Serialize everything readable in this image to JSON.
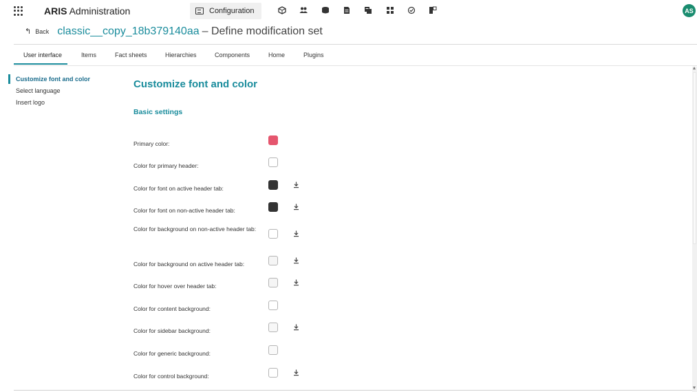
{
  "app": {
    "brand_bold": "ARIS",
    "brand_rest": "Administration",
    "active_module": "Configuration",
    "avatar_initials": "AS",
    "accent_color": "#1a8c9c",
    "avatar_color": "#1a8c6f",
    "toolbar_icons": [
      "cube-icon",
      "users-icon",
      "database-icon",
      "document-icon",
      "grid-icon",
      "check-circle-icon",
      "layout-icon"
    ]
  },
  "header": {
    "back_label": "Back",
    "set_name": "classic__copy_18b379140aa",
    "set_suffix": "– Define modification set"
  },
  "tabs": [
    {
      "label": "User interface",
      "active": true
    },
    {
      "label": "Items",
      "active": false
    },
    {
      "label": "Fact sheets",
      "active": false
    },
    {
      "label": "Hierarchies",
      "active": false
    },
    {
      "label": "Components",
      "active": false
    },
    {
      "label": "Home",
      "active": false
    },
    {
      "label": "Plugins",
      "active": false
    }
  ],
  "leftnav": {
    "items": [
      {
        "label": "Customize font and color",
        "active": true
      },
      {
        "label": "Select language",
        "active": false
      },
      {
        "label": "Insert logo",
        "active": false
      }
    ]
  },
  "main": {
    "title": "Customize font and color",
    "section": "Basic settings",
    "settings": [
      {
        "label": "Primary color:",
        "color": "#e5566e",
        "download": false
      },
      {
        "label": "Color for primary header:",
        "color": "#ffffff",
        "download": false
      },
      {
        "label": "Color for font on active header tab:",
        "color": "#333333",
        "download": true
      },
      {
        "label": "Color for font on non-active header tab:",
        "color": "#333333",
        "download": true
      },
      {
        "label": "Color for background on non-active header tab:",
        "color": "#ffffff",
        "download": true
      },
      {
        "label": "Color for background on active header tab:",
        "color": "#f5f5f5",
        "download": true
      },
      {
        "label": "Color for hover over header tab:",
        "color": "#f5f5f5",
        "download": true
      },
      {
        "label": "Color for content background:",
        "color": "#ffffff",
        "download": false
      },
      {
        "label": "Color for sidebar background:",
        "color": "#f7f7f7",
        "download": true
      },
      {
        "label": "Color for generic background:",
        "color": "#f9f9f9",
        "download": false
      },
      {
        "label": "Color for control background:",
        "color": "#ffffff",
        "download": true
      }
    ]
  }
}
